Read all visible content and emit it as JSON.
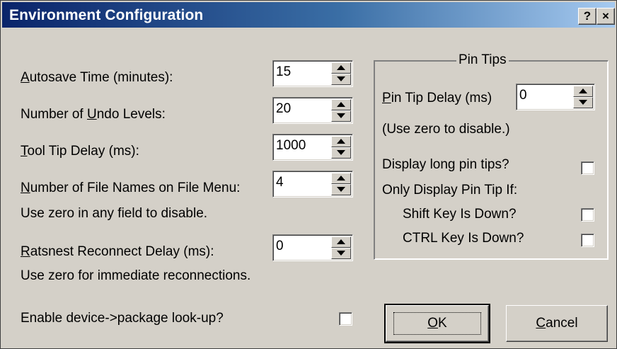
{
  "window": {
    "title": "Environment Configuration",
    "help_label": "?",
    "close_label": "×"
  },
  "fields": [
    {
      "pre": "",
      "accel": "A",
      "post": "utosave Time (minutes):",
      "value": "15"
    },
    {
      "pre": "Number of ",
      "accel": "U",
      "post": "ndo Levels:",
      "value": "20"
    },
    {
      "pre": "",
      "accel": "T",
      "post": "ool Tip Delay (ms):",
      "value": "1000"
    },
    {
      "pre": "",
      "accel": "N",
      "post": "umber of File Names on File Menu:",
      "value": "4"
    },
    {
      "pre": "",
      "accel": "R",
      "post": "atsnest Reconnect Delay (ms):",
      "value": "0"
    }
  ],
  "notes": {
    "zero_disable": "Use zero in any field to disable.",
    "zero_immediate": "Use zero for immediate reconnections."
  },
  "device_lookup": {
    "label": "Enable device->package look-up?",
    "checked": false
  },
  "pin_tips": {
    "legend": "Pin Tips",
    "delay_pre": "",
    "delay_accel": "P",
    "delay_post": "in Tip Delay (ms)",
    "delay_value": "0",
    "zero_note": "(Use zero to disable.)",
    "long_tips_label": "Display long pin tips?",
    "only_if_label": "Only Display Pin Tip If:",
    "shift_label": "Shift Key Is Down?",
    "ctrl_label": "CTRL Key Is Down?"
  },
  "buttons": {
    "ok_accel": "O",
    "ok_rest": "K",
    "cancel_accel": "C",
    "cancel_rest": "ancel"
  }
}
